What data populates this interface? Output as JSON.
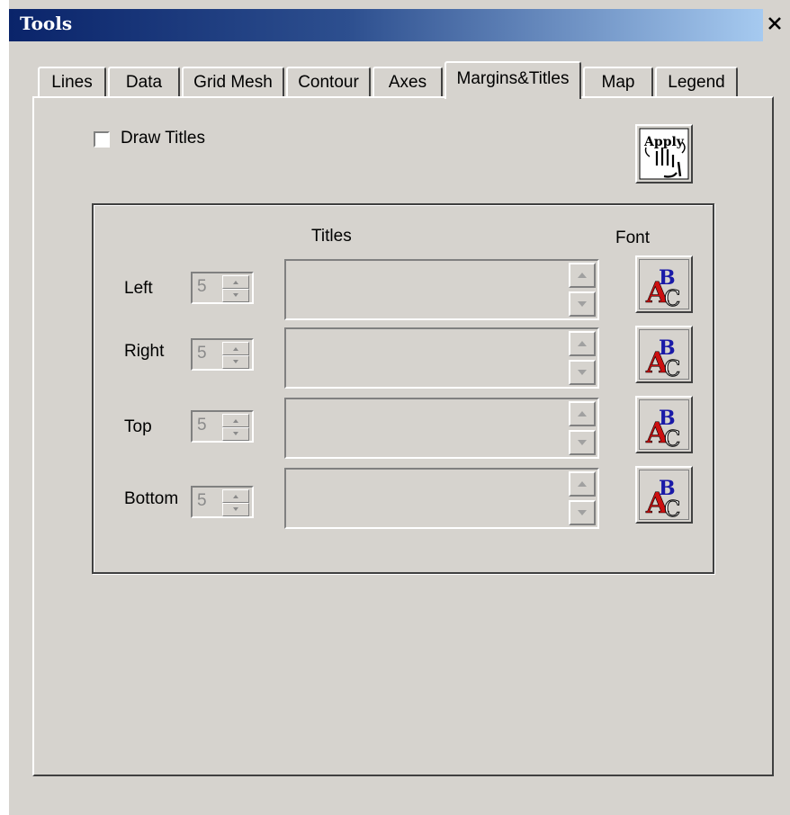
{
  "window": {
    "title": "Tools",
    "close_symbol": "×"
  },
  "tabs": [
    {
      "label": "Lines"
    },
    {
      "label": "Data"
    },
    {
      "label": "Grid Mesh"
    },
    {
      "label": "Contour"
    },
    {
      "label": "Axes"
    },
    {
      "label": "Margins&Titles",
      "active": true
    },
    {
      "label": "Map"
    },
    {
      "label": "Legend"
    }
  ],
  "panel": {
    "draw_titles_label": "Draw Titles",
    "draw_titles_checked": false,
    "apply_label": "Apply",
    "headers": {
      "titles": "Titles",
      "font": "Font"
    },
    "rows": [
      {
        "label": "Left",
        "value": "5",
        "title": ""
      },
      {
        "label": "Right",
        "value": "5",
        "title": ""
      },
      {
        "label": "Top",
        "value": "5",
        "title": ""
      },
      {
        "label": "Bottom",
        "value": "5",
        "title": ""
      }
    ]
  },
  "icons": {
    "apply": "apply-hand-icon",
    "font": "font-abc-icon",
    "close": "close-icon",
    "spin_up": "arrow-up-icon",
    "spin_down": "arrow-down-icon"
  },
  "colors": {
    "titlebar_start": "#0a246a",
    "titlebar_end": "#a6caf0",
    "face": "#d6d3ce",
    "font_icon_red": "#cc1010",
    "font_icon_blue": "#1a1aa8"
  }
}
